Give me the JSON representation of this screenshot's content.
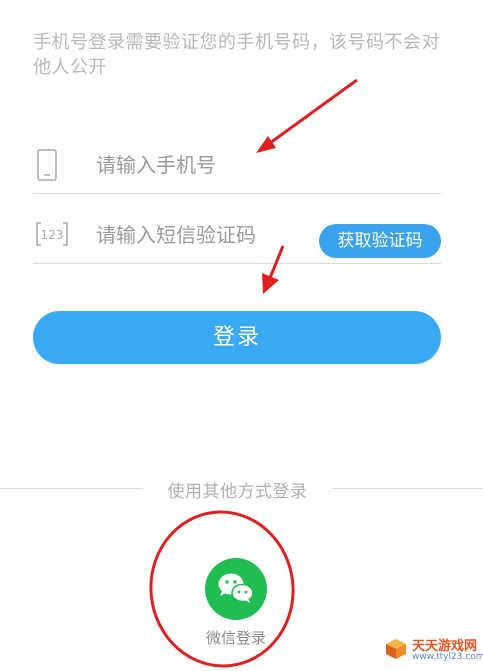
{
  "notice": "手机号登录需要验证您的手机号码，该号码不会对他人公开",
  "phone_field": {
    "icon": "phone-icon",
    "placeholder": "请输入手机号",
    "value": ""
  },
  "code_field": {
    "icon": "code-123-icon",
    "icon_text": "123",
    "placeholder": "请输入短信验证码",
    "value": "",
    "get_code_button": "获取验证码"
  },
  "login_button": "登录",
  "other_methods": {
    "label": "使用其他方式登录",
    "wechat": {
      "icon": "wechat-icon",
      "label": "微信登录"
    }
  },
  "watermark": {
    "title": "天天游戏网",
    "url": "www.ttyl23.com"
  },
  "colors": {
    "primary": "#3aa9f4",
    "wechat": "#1fbd52",
    "annotation": "#e02020",
    "text_muted": "#b8b8b8"
  }
}
